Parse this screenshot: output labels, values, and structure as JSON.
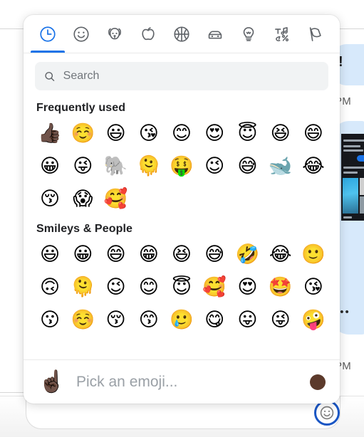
{
  "picker": {
    "tabs": [
      {
        "name": "recent",
        "icon": "clock-icon",
        "active": true
      },
      {
        "name": "smileys",
        "icon": "smiley-icon",
        "active": false
      },
      {
        "name": "animals",
        "icon": "dog-icon",
        "active": false
      },
      {
        "name": "food",
        "icon": "apple-icon",
        "active": false
      },
      {
        "name": "activity",
        "icon": "basketball-icon",
        "active": false
      },
      {
        "name": "travel",
        "icon": "car-icon",
        "active": false
      },
      {
        "name": "objects",
        "icon": "lightbulb-icon",
        "active": false
      },
      {
        "name": "symbols",
        "icon": "symbols-icon",
        "active": false
      },
      {
        "name": "flags",
        "icon": "flag-icon",
        "active": false
      }
    ],
    "search": {
      "placeholder": "Search",
      "value": ""
    },
    "sections": [
      {
        "title": "Frequently used",
        "emojis": [
          "👍🏿",
          "☺️",
          "😃",
          "😘",
          "😊",
          "😍",
          "😇",
          "😆",
          "😄",
          "😀",
          "😜",
          "🐘",
          "🫠",
          "🤑",
          "😉",
          "😅",
          "🐋",
          "😂",
          "😚",
          "😱",
          "🥰"
        ]
      },
      {
        "title": "Smileys & People",
        "emojis": [
          "😃",
          "😀",
          "😄",
          "😁",
          "😆",
          "😅",
          "🤣",
          "😂",
          "🙂",
          "🙃",
          "🫠",
          "😉",
          "😊",
          "😇",
          "🥰",
          "😍",
          "🤩",
          "😘",
          "😗",
          "☺️",
          "😚",
          "😙",
          "🥲",
          "😋",
          "😛",
          "😜",
          "🤪"
        ]
      }
    ],
    "footer": {
      "preview_emoji": "☝🏿",
      "hint": "Pick an emoji...",
      "skin_tone_color": "#5c3a2b"
    }
  },
  "background": {
    "bubble_text": "!",
    "timestamp_top": "PM",
    "timestamp_bottom": "PM",
    "typing_dots": "•••"
  },
  "colors": {
    "accent": "#1a73e8",
    "focus_ring": "#1a56c4",
    "search_background": "#f1f3f4",
    "bubble": "#d7e9fb"
  }
}
